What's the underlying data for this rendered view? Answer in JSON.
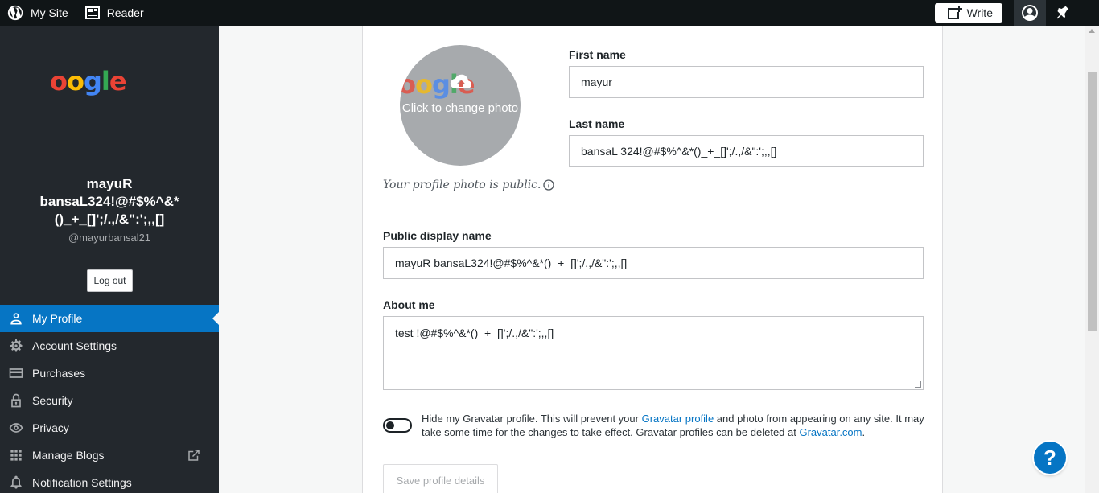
{
  "masterbar": {
    "my_site": "My Site",
    "reader": "Reader",
    "write": "Write"
  },
  "sidebar": {
    "logo_text": "oogle",
    "display_name": "mayuR bansaL324!@#$%^&*()_+_[]';/.,/&\":';,,[]",
    "username": "@mayurbansal21",
    "logout": "Log out",
    "items": [
      {
        "label": "My Profile",
        "icon": "person-icon",
        "active": true
      },
      {
        "label": "Account Settings",
        "icon": "gear-icon"
      },
      {
        "label": "Purchases",
        "icon": "credit-card-icon"
      },
      {
        "label": "Security",
        "icon": "lock-icon"
      },
      {
        "label": "Privacy",
        "icon": "eye-icon"
      },
      {
        "label": "Manage Blogs",
        "icon": "grid-icon"
      },
      {
        "label": "Notification Settings",
        "icon": "bell-icon"
      }
    ]
  },
  "profile": {
    "photo_logo": "oogle",
    "photo_action": "Click to change photo",
    "photo_note": "Your profile photo is public.",
    "first_name_label": "First name",
    "first_name_value": "mayur",
    "last_name_label": "Last name",
    "last_name_value": "bansaL 324!@#$%^&*()_+_[]';/.,/&\":';,,[]",
    "display_name_label": "Public display name",
    "display_name_value": "mayuR bansaL324!@#$%^&*()_+_[]';/.,/&\":';,,[]",
    "about_label": "About me",
    "about_value": "test !@#$%^&*()_+_[]';/.,/&\":';,,[]",
    "gravatar_text_1": "Hide my Gravatar profile. This will prevent your ",
    "gravatar_link_1": "Gravatar profile",
    "gravatar_text_2": " and photo from appearing on any site. It may take some time for the changes to take effect. Gravatar profiles can be deleted at ",
    "gravatar_link_2": "Gravatar.com",
    "gravatar_text_3": ".",
    "save": "Save profile details"
  },
  "help": {
    "label": "?"
  },
  "colors": {
    "accent": "#0675c4",
    "sidebar_bg": "#23282d",
    "masterbar_bg": "#101517"
  }
}
